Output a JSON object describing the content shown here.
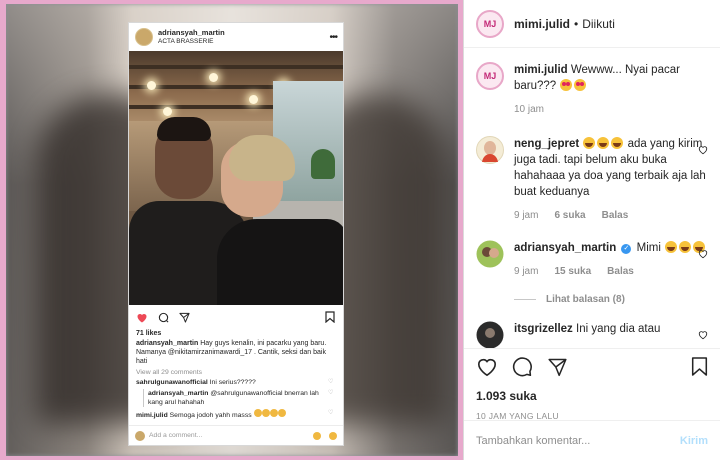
{
  "post_image": {
    "header": {
      "username": "adriansyah_martin",
      "location": "ACTA BRASSERIE"
    },
    "likes": "71 likes",
    "caption": {
      "username": "adriansyah_martin",
      "text": "Hay guys kenalin, ini pacarku yang baru. Namanya @nikitamirzanimawardi_17 . Cantik, seksi dan baik hati"
    },
    "view_all": "View all 29 comments",
    "comments": [
      {
        "username": "sahrulgunawanofficial",
        "text": "Ini serius?????"
      },
      {
        "username": "adriansyah_martin",
        "text": "@sahrulgunawanofficial bnerran lah kang arul hahahah"
      },
      {
        "username": "mimi.julid",
        "text": "Semoga jodoh yahh masss"
      }
    ],
    "add_comment_placeholder": "Add a comment..."
  },
  "sidebar": {
    "header": {
      "avatar_text": "MJ",
      "username": "mimi.julid",
      "dot": "•",
      "follow_status": "Diikuti"
    },
    "comments": [
      {
        "avatar_text": "MJ",
        "username": "mimi.julid",
        "text": "Wewww... Nyai pacar baru???",
        "time": "10 jam"
      },
      {
        "username": "neng_jepret",
        "text": "ada yang kirim juga tadi. tapi belum aku buka hahahaaa ya doa yang terbaik aja lah buat keduanya",
        "time": "9 jam",
        "likes": "6 suka",
        "reply": "Balas"
      },
      {
        "username": "adriansyah_martin",
        "text": "Mimi",
        "time": "9 jam",
        "likes": "15 suka",
        "reply": "Balas",
        "view_replies": "Lihat balasan (8)"
      },
      {
        "username": "itsgrizellez",
        "text": "Ini yang dia atau"
      }
    ],
    "likes": "1.093 suka",
    "date": "10 JAM YANG LALU",
    "comment_placeholder": "Tambahkan komentar...",
    "post_label": "Kirim"
  },
  "colors": {
    "frame_pink": "#e7a9cc",
    "like_red": "#ed4956",
    "verified_blue": "#3897f0",
    "link_grey": "#8e8e8e",
    "post_disabled": "#b2dffc"
  },
  "icons": [
    "heart-icon",
    "comment-icon",
    "share-icon",
    "bookmark-icon",
    "more-icon",
    "verified-icon"
  ]
}
